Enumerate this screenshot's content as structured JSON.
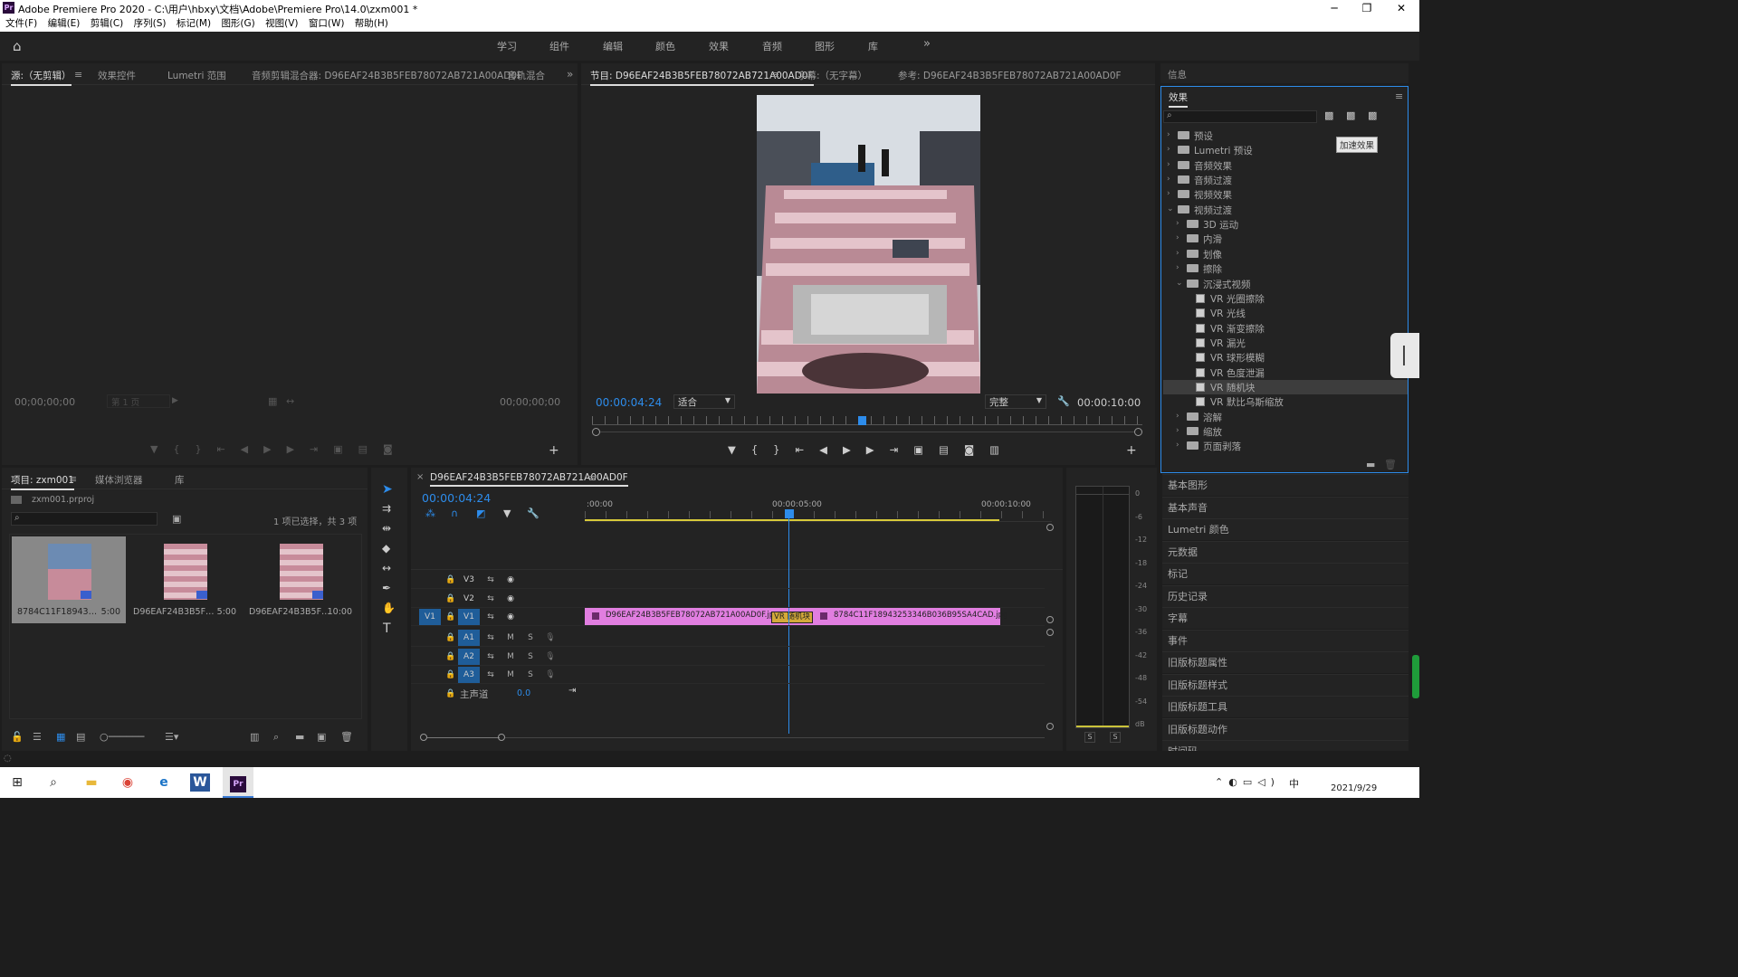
{
  "window": {
    "title": "Adobe Premiere Pro 2020 - C:\\用户\\hbxy\\文档\\Adobe\\Premiere Pro\\14.0\\zxm001 *",
    "controls": [
      "─",
      "❐",
      "✕"
    ]
  },
  "menu": [
    "文件(F)",
    "编辑(E)",
    "剪辑(C)",
    "序列(S)",
    "标记(M)",
    "图形(G)",
    "视图(V)",
    "窗口(W)",
    "帮助(H)"
  ],
  "workspaces": [
    "学习",
    "组件",
    "编辑",
    "颜色",
    "效果",
    "音频",
    "图形",
    "库"
  ],
  "workspace_more": "»",
  "source_panel": {
    "tabs": [
      "源:（无剪辑）",
      "效果控件",
      "Lumetri 范围",
      "音频剪辑混合器: D96EAF24B3B5FEB78072AB721A00AD0F",
      "音轨混合"
    ],
    "timecode_left": "00;00;00;00",
    "page_dropdown": "第 1 页",
    "timecode_right": "00;00;00;00"
  },
  "program_panel": {
    "tabs": [
      "节目: D96EAF24B3B5FEB78072AB721A00AD0F",
      "字幕:（无字幕）",
      "参考: D96EAF24B3B5FEB78072AB721A00AD0F"
    ],
    "timecode": "00:00:04:24",
    "fit": "适合",
    "quality": "完整",
    "duration": "00:00:10:00",
    "playhead_fraction": 0.49
  },
  "info_panel": {
    "title": "信息"
  },
  "effects_panel": {
    "title": "效果",
    "tooltip": "加速效果",
    "tree": [
      {
        "label": "预设",
        "level": 0,
        "type": "folder",
        "expanded": false
      },
      {
        "label": "Lumetri 预设",
        "level": 0,
        "type": "folder",
        "expanded": false
      },
      {
        "label": "音频效果",
        "level": 0,
        "type": "folder",
        "expanded": false
      },
      {
        "label": "音频过渡",
        "level": 0,
        "type": "folder",
        "expanded": false
      },
      {
        "label": "视频效果",
        "level": 0,
        "type": "folder",
        "expanded": false
      },
      {
        "label": "视频过渡",
        "level": 0,
        "type": "folder",
        "expanded": true
      },
      {
        "label": "3D 运动",
        "level": 1,
        "type": "folder",
        "expanded": false
      },
      {
        "label": "内滑",
        "level": 1,
        "type": "folder",
        "expanded": false
      },
      {
        "label": "划像",
        "level": 1,
        "type": "folder",
        "expanded": false
      },
      {
        "label": "擦除",
        "level": 1,
        "type": "folder",
        "expanded": false
      },
      {
        "label": "沉浸式视频",
        "level": 1,
        "type": "folder",
        "expanded": true
      },
      {
        "label": "VR 光圈擦除",
        "level": 2,
        "type": "fx"
      },
      {
        "label": "VR 光线",
        "level": 2,
        "type": "fx"
      },
      {
        "label": "VR 渐变擦除",
        "level": 2,
        "type": "fx"
      },
      {
        "label": "VR 漏光",
        "level": 2,
        "type": "fx"
      },
      {
        "label": "VR 球形模糊",
        "level": 2,
        "type": "fx"
      },
      {
        "label": "VR 色度泄漏",
        "level": 2,
        "type": "fx"
      },
      {
        "label": "VR 随机块",
        "level": 2,
        "type": "fx",
        "selected": true
      },
      {
        "label": "VR 默比乌斯缩放",
        "level": 2,
        "type": "fx"
      },
      {
        "label": "溶解",
        "level": 1,
        "type": "folder",
        "expanded": false
      },
      {
        "label": "缩放",
        "level": 1,
        "type": "folder",
        "expanded": false
      },
      {
        "label": "页面剥落",
        "level": 1,
        "type": "folder",
        "expanded": false
      }
    ]
  },
  "side_panels": [
    "基本图形",
    "基本声音",
    "Lumetri 颜色",
    "元数据",
    "标记",
    "历史记录",
    "字幕",
    "事件",
    "旧版标题属性",
    "旧版标题样式",
    "旧版标题工具",
    "旧版标题动作",
    "时间码"
  ],
  "project_panel": {
    "tabs": [
      "项目: zxm001",
      "媒体浏览器",
      "库"
    ],
    "file": "zxm001.prproj",
    "selection": "1 项已选择，共 3 项",
    "items": [
      {
        "name": "8784C11F18943253...",
        "duration": "5:00",
        "selected": true
      },
      {
        "name": "D96EAF24B3B5FEB...",
        "duration": "5:00",
        "selected": false
      },
      {
        "name": "D96EAF24B3B5FE...",
        "duration": "10:00",
        "selected": false
      }
    ]
  },
  "timeline": {
    "sequence": "D96EAF24B3B5FEB78072AB721A00AD0F",
    "timecode": "00:00:04:24",
    "ruler": [
      ":00:00",
      "00:00:05:00",
      "00:00:10:00"
    ],
    "video_tracks": [
      "V3",
      "V2",
      "V1"
    ],
    "audio_tracks": [
      "A1",
      "A2",
      "A3"
    ],
    "master": "主声道",
    "master_value": "0.0",
    "clip1": "D96EAF24B3B5FEB78072AB721A00AD0F.jpg",
    "clip2": "8784C11F18943253346B036B95SA4CAD.jpg",
    "transition": "VR 随机块",
    "playhead_fraction": 0.49
  },
  "meter": {
    "ticks": [
      "0",
      "-6",
      "-12",
      "-18",
      "-24",
      "-30",
      "-36",
      "-42",
      "-48",
      "-54",
      "dB"
    ],
    "solo": [
      "S",
      "S"
    ]
  },
  "taskbar": {
    "date": "2021/9/29",
    "ime": "中"
  },
  "colors": {
    "accent_blue": "#2d8ceb",
    "clip_pink": "#e17ee0",
    "workspace_bg": "#232323"
  }
}
